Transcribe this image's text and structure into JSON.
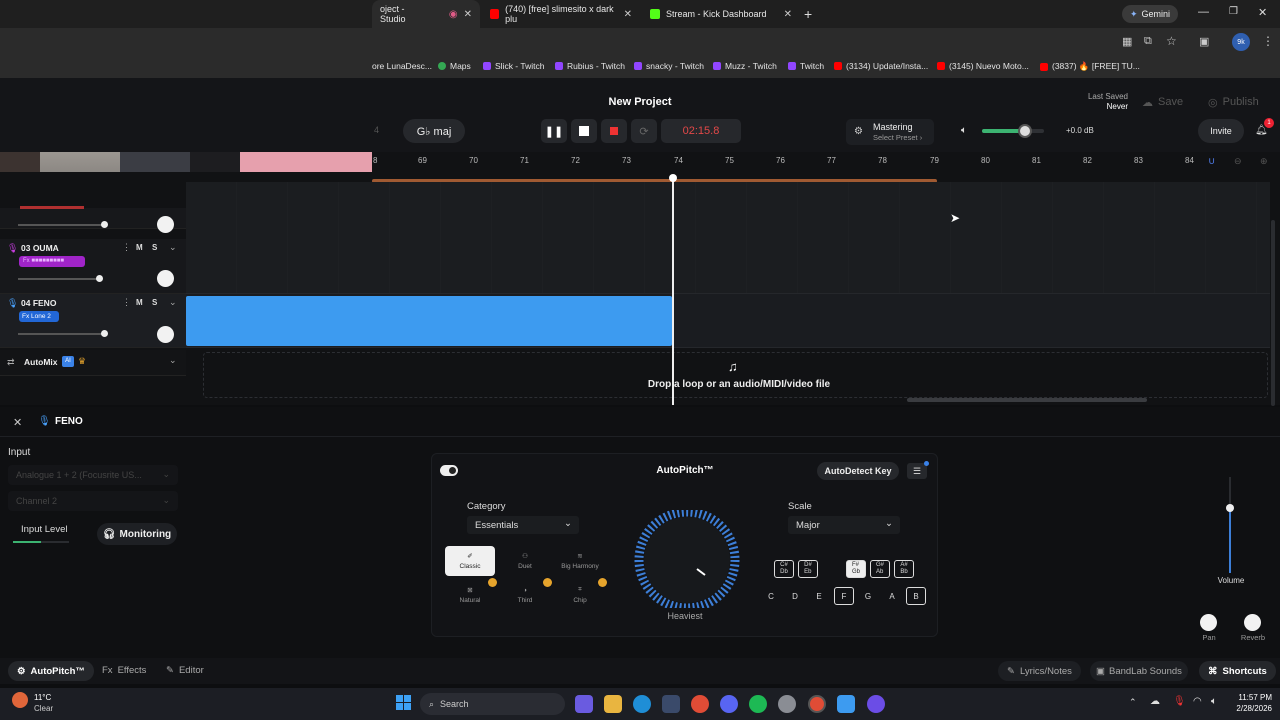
{
  "browser": {
    "tabs": [
      {
        "label": "oject - Studio"
      },
      {
        "label": "(740) [free] slimesito x dark plu"
      },
      {
        "label": "Stream - Kick Dashboard"
      }
    ],
    "gemini_label": "Gemini",
    "profile_badge": "9k",
    "bookmarks": [
      "ore LunaDesc...",
      "Maps",
      "Slick - Twitch",
      "Rubius - Twitch",
      "snacky - Twitch",
      "Muzz - Twitch",
      "Twitch",
      "(3134) Update/Insta...",
      "(3145) Nuevo Moto...",
      "(3837) 🔥 [FREE] TU..."
    ]
  },
  "daw": {
    "project_title": "New Project",
    "last_saved_label": "Last Saved",
    "last_saved_value": "Never",
    "save_label": "Save",
    "publish_label": "Publish",
    "key_label": "G♭ maj",
    "left_partial": "4",
    "time_display": "02:15.8",
    "mastering_label": "Mastering",
    "mastering_preset": "Select Preset ›",
    "volume_db": "+0.0 dB",
    "invite_label": "Invite",
    "notif_count": "1",
    "ruler_ticks": [
      "8",
      "69",
      "70",
      "71",
      "72",
      "73",
      "74",
      "75",
      "76",
      "77",
      "78",
      "79",
      "80",
      "81",
      "82",
      "83",
      "84"
    ],
    "tracks": [
      {
        "name": "03  OUMA",
        "fx": "Fx ■■■■■■■■■",
        "m": "M",
        "s": "S"
      },
      {
        "name": "04  FENO",
        "fx": "Fx Lone 2",
        "m": "M",
        "s": "S"
      }
    ],
    "automix_label": "AutoMix",
    "automix_ai": "AI",
    "drop_text": "Drop a loop or an audio/MIDI/video file"
  },
  "panel": {
    "track_name": "FENO",
    "input_label": "Input",
    "input_device": "Analogue 1 + 2 (Focusrite US...",
    "channel": "Channel 2",
    "input_level_label": "Input Level",
    "monitoring_label": "Monitoring",
    "autopitch_title": "AutoPitch™",
    "autodetect_label": "AutoDetect Key",
    "category_label": "Category",
    "category_value": "Essentials",
    "modes": [
      {
        "label": "Classic",
        "icon": "classic-icon"
      },
      {
        "label": "Duet",
        "icon": "duet-icon"
      },
      {
        "label": "Big Harmony",
        "icon": "big-harmony-icon"
      },
      {
        "label": "Natural",
        "icon": "natural-icon"
      },
      {
        "label": "Third",
        "icon": "third-icon"
      },
      {
        "label": "Chip",
        "icon": "chip-icon"
      }
    ],
    "knob_label": "Heaviest",
    "scale_label": "Scale",
    "scale_value": "Major",
    "sharp_keys": [
      "C#\nDb",
      "D#\nEb",
      "F#\nGb",
      "G#\nAb",
      "A#\nBb"
    ],
    "natural_keys": [
      "C",
      "D",
      "E",
      "F",
      "G",
      "A",
      "B"
    ],
    "volume_label": "Volume",
    "pan_label": "Pan",
    "reverb_label": "Reverb"
  },
  "bottom_bar": {
    "autopitch_tab": "AutoPitch™",
    "effects_tab": "Effects",
    "editor_tab": "Editor",
    "lyrics_label": "Lyrics/Notes",
    "sounds_label": "BandLab Sounds",
    "shortcuts_label": "Shortcuts"
  },
  "taskbar": {
    "weather_temp": "11°C",
    "weather_desc": "Clear",
    "search_label": "Search",
    "time": "11:57 PM",
    "date": "2/28/2026"
  }
}
